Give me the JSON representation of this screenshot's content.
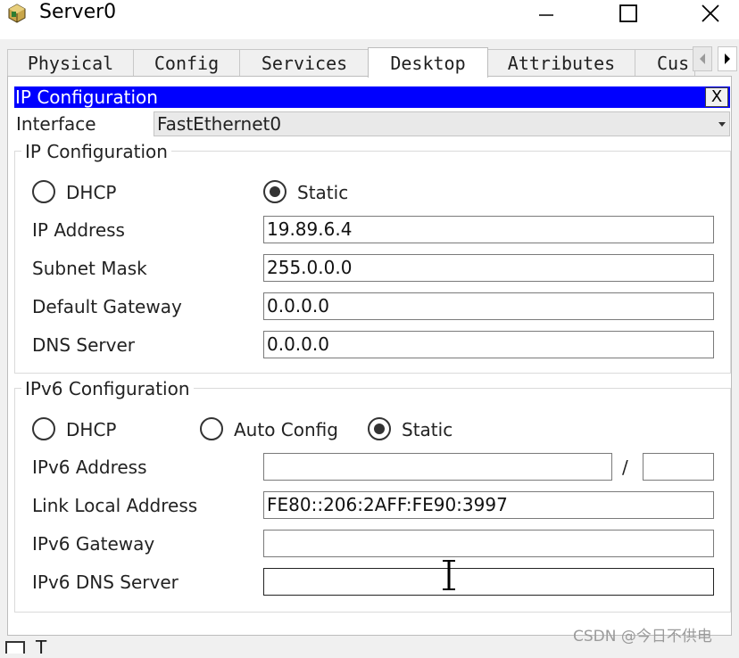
{
  "window": {
    "title": "Server0",
    "icon": "server-app-icon"
  },
  "tabs": [
    {
      "label": "Physical",
      "active": false
    },
    {
      "label": "Config",
      "active": false
    },
    {
      "label": "Services",
      "active": false
    },
    {
      "label": "Desktop",
      "active": true
    },
    {
      "label": "Attributes",
      "active": false
    },
    {
      "label": "Cus",
      "active": false
    }
  ],
  "ip_panel": {
    "title": "IP Configuration",
    "close_label": "X",
    "interface_label": "Interface",
    "interface_value": "FastEthernet0"
  },
  "ipv4": {
    "legend": "IP Configuration",
    "dhcp_label": "DHCP",
    "static_label": "Static",
    "selected": "Static",
    "ip_label": "IP Address",
    "ip_value": "19.89.6.4",
    "mask_label": "Subnet Mask",
    "mask_value": "255.0.0.0",
    "gateway_label": "Default Gateway",
    "gateway_value": "0.0.0.0",
    "dns_label": "DNS Server",
    "dns_value": "0.0.0.0"
  },
  "ipv6": {
    "legend": "IPv6 Configuration",
    "dhcp_label": "DHCP",
    "auto_label": "Auto Config",
    "static_label": "Static",
    "selected": "Static",
    "address_label": "IPv6 Address",
    "address_value": "",
    "prefix_separator": "/",
    "prefix_value": "",
    "link_local_label": "Link Local Address",
    "link_local_value": "FE80::206:2AFF:FE90:3997",
    "gateway_label": "IPv6 Gateway",
    "gateway_value": "",
    "dns_label": "IPv6 DNS Server",
    "dns_value": ""
  },
  "footer": {
    "partial_text": "T",
    "watermark": "CSDN @今日不供电"
  },
  "colors": {
    "header_bar": "#0000ff",
    "pane_bg": "#ffffff",
    "window_bg": "#f0f0f0"
  }
}
